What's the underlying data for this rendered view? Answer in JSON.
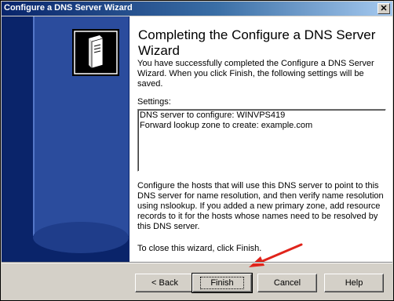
{
  "window": {
    "title": "Configure a DNS Server Wizard",
    "close_glyph": "✕"
  },
  "main": {
    "heading": "Completing the Configure a DNS Server Wizard",
    "intro": "You have successfully completed the Configure a DNS Server Wizard. When you click Finish, the following settings will be saved.",
    "settings_label": "Settings:",
    "settings": [
      "DNS server to configure: WINVPS419",
      "Forward lookup zone to create: example.com"
    ],
    "instructions": "Configure the hosts that will use this DNS server to point to this DNS server for name resolution, and then verify name resolution using nslookup. If you added a new primary zone, add resource records to it for the hosts whose names need to be resolved by this DNS server.",
    "close_note": "To close this wizard, click Finish."
  },
  "buttons": {
    "back": "< Back",
    "finish": "Finish",
    "cancel": "Cancel",
    "help": "Help"
  },
  "annotation": {
    "arrow_color": "#e0241b"
  },
  "colors": {
    "title_bar": "#0a246a",
    "watermark": "#2b4c9d",
    "dialog_bg": "#d4d0c8"
  }
}
